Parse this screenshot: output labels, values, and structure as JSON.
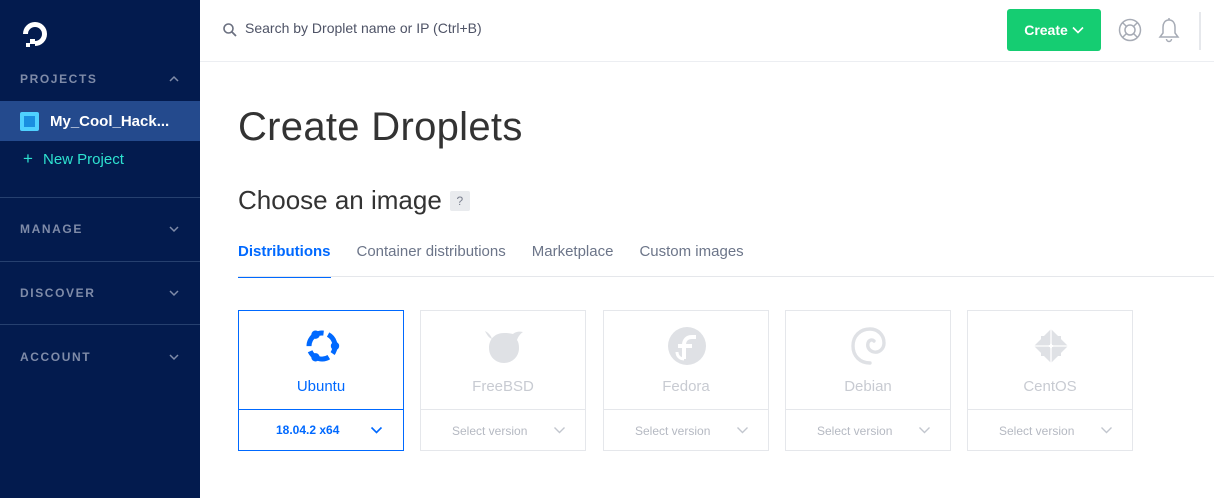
{
  "sidebar": {
    "projects_header": "PROJECTS",
    "project_name": "My_Cool_Hack...",
    "new_project": "New Project",
    "manage_header": "MANAGE",
    "discover_header": "DISCOVER",
    "account_header": "ACCOUNT"
  },
  "topbar": {
    "search_placeholder": "Search by Droplet name or IP (Ctrl+B)",
    "create_label": "Create"
  },
  "main": {
    "title": "Create Droplets",
    "section_title": "Choose an image",
    "help_badge": "?",
    "tabs": [
      {
        "label": "Distributions",
        "active": true
      },
      {
        "label": "Container distributions",
        "active": false
      },
      {
        "label": "Marketplace",
        "active": false
      },
      {
        "label": "Custom images",
        "active": false
      }
    ],
    "images": [
      {
        "name": "Ubuntu",
        "version": "18.04.2 x64",
        "selected": true,
        "icon": "ubuntu-icon"
      },
      {
        "name": "FreeBSD",
        "version": "Select version",
        "selected": false,
        "icon": "freebsd-icon"
      },
      {
        "name": "Fedora",
        "version": "Select version",
        "selected": false,
        "icon": "fedora-icon"
      },
      {
        "name": "Debian",
        "version": "Select version",
        "selected": false,
        "icon": "debian-icon"
      },
      {
        "name": "CentOS",
        "version": "Select version",
        "selected": false,
        "icon": "centos-icon"
      }
    ]
  },
  "colors": {
    "sidebar_bg": "#031b4e",
    "accent_blue": "#0069ff",
    "create_green": "#15cd72",
    "new_project_teal": "#2ee2d0"
  }
}
